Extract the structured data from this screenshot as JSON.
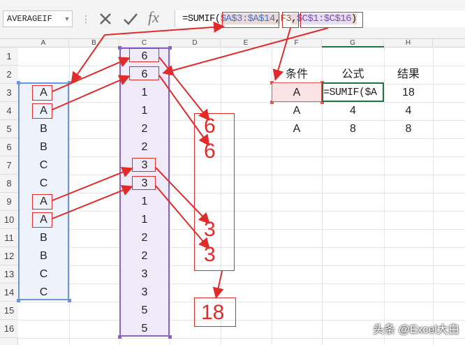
{
  "name_box": {
    "value": "AVERAGEIF"
  },
  "formula": {
    "parts": [
      {
        "text": "=SUMIF(",
        "cls": "tok-fn"
      },
      {
        "text": "$A$3:$A$14",
        "cls": "tok-r1"
      },
      {
        "text": ",",
        "cls": "tok-p"
      },
      {
        "text": "F3",
        "cls": "tok-r2"
      },
      {
        "text": ",",
        "cls": "tok-p"
      },
      {
        "text": "$C$1:$C$16",
        "cls": "tok-r3"
      },
      {
        "text": ")",
        "cls": "tok-p"
      }
    ]
  },
  "toolbar": {
    "dots": "⋮",
    "fx": "fx"
  },
  "columns": [
    "A",
    "B",
    "C",
    "D",
    "E",
    "F",
    "G",
    "H"
  ],
  "rows": [
    "1",
    "2",
    "3",
    "4",
    "5",
    "6",
    "7",
    "8",
    "9",
    "10",
    "11",
    "12",
    "13",
    "14",
    "15",
    "16"
  ],
  "col_a": [
    "A",
    "A",
    "B",
    "B",
    "C",
    "C",
    "A",
    "A",
    "B",
    "B",
    "C",
    "C"
  ],
  "col_c": [
    "6",
    "6",
    "1",
    "1",
    "2",
    "2",
    "3",
    "3",
    "1",
    "1",
    "2",
    "2",
    "3",
    "3",
    "5",
    "5"
  ],
  "table": {
    "headers": [
      "条件",
      "公式",
      "结果"
    ],
    "rows": [
      [
        "A",
        "=SUMIF($A",
        "18"
      ],
      [
        "A",
        "4",
        "4"
      ],
      [
        "A",
        "8",
        "8"
      ]
    ]
  },
  "annotation": {
    "values": [
      "6",
      "6",
      "3",
      "3"
    ],
    "total": "18"
  },
  "colors": {
    "arrow": "#e02b2b",
    "range_a": "#6d93d8",
    "range_c": "#8a63c4",
    "active": "#217346"
  },
  "watermark": "头条 @Excel大白"
}
